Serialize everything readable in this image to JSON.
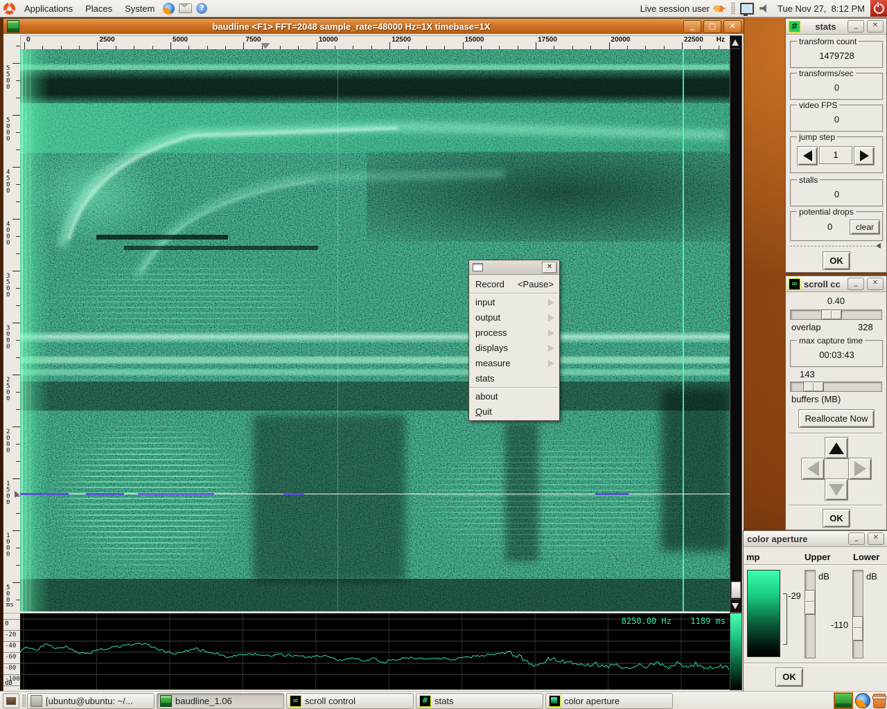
{
  "colors": {
    "titlebar_orange": "#cf7426",
    "spectro_green": "#2fe39b",
    "panel_bg": "#efebe5",
    "desktop_brown": "#5a2e0e"
  },
  "panel": {
    "menus": [
      "Applications",
      "Places",
      "System"
    ],
    "help_glyph": "?",
    "user_label": "Live session user",
    "clock": "Tue Nov 27,  8:12 PM"
  },
  "baudline": {
    "title": "baudline  <F1> FFT=2048 sample_rate=48000 Hz=1X timebase=1X",
    "window_buttons": {
      "minimize": "_",
      "maximize": "□",
      "close": "✕"
    },
    "freq_axis": {
      "ticks": [
        "0",
        "2500",
        "5000",
        "7500",
        "10000",
        "12500",
        "15000",
        "17500",
        "20000",
        "22500"
      ],
      "unit": "Hz",
      "marker_hz": 8250
    },
    "time_axis": {
      "ticks": [
        "5500",
        "5000",
        "4500",
        "4000",
        "3500",
        "3000",
        "2500",
        "2000",
        "1500",
        "1000",
        "500"
      ],
      "unit": "ms",
      "marker_ms": 1189
    },
    "db_axis": {
      "ticks": [
        "0",
        "-20",
        "-40",
        "-60",
        "-80",
        "-100"
      ],
      "unit": "dB"
    },
    "readout": {
      "freq": "8250.00 Hz",
      "time": "1189 ms"
    },
    "spectrum_trace": [
      [
        0,
        -58
      ],
      [
        10,
        -50
      ],
      [
        22,
        -56
      ],
      [
        38,
        -46
      ],
      [
        52,
        -52
      ],
      [
        66,
        -49
      ],
      [
        80,
        -58
      ],
      [
        95,
        -64
      ],
      [
        110,
        -57
      ],
      [
        130,
        -52
      ],
      [
        150,
        -49
      ],
      [
        168,
        -44
      ],
      [
        180,
        -46
      ],
      [
        195,
        -52
      ],
      [
        210,
        -60
      ],
      [
        225,
        -63
      ],
      [
        240,
        -57
      ],
      [
        255,
        -54
      ],
      [
        268,
        -58
      ],
      [
        285,
        -63
      ],
      [
        300,
        -68
      ],
      [
        320,
        -66
      ],
      [
        340,
        -64
      ],
      [
        360,
        -66
      ],
      [
        380,
        -65
      ],
      [
        400,
        -67
      ],
      [
        420,
        -69
      ],
      [
        435,
        -66
      ],
      [
        450,
        -71
      ],
      [
        465,
        -74
      ],
      [
        480,
        -71
      ],
      [
        495,
        -76
      ],
      [
        510,
        -72
      ],
      [
        525,
        -78
      ],
      [
        540,
        -73
      ],
      [
        555,
        -71
      ],
      [
        570,
        -70
      ],
      [
        585,
        -72
      ],
      [
        600,
        -73
      ],
      [
        615,
        -71
      ],
      [
        630,
        -73
      ],
      [
        645,
        -69
      ],
      [
        660,
        -67
      ],
      [
        675,
        -64
      ],
      [
        690,
        -62
      ],
      [
        705,
        -62
      ],
      [
        715,
        -64
      ],
      [
        725,
        -70
      ],
      [
        735,
        -78
      ],
      [
        742,
        -88
      ],
      [
        750,
        -80
      ],
      [
        760,
        -74
      ],
      [
        772,
        -72
      ],
      [
        785,
        -75
      ],
      [
        800,
        -79
      ],
      [
        815,
        -83
      ],
      [
        830,
        -79
      ],
      [
        845,
        -86
      ],
      [
        860,
        -82
      ],
      [
        875,
        -87
      ],
      [
        890,
        -84
      ],
      [
        905,
        -86
      ],
      [
        920,
        -81
      ],
      [
        935,
        -88
      ],
      [
        948,
        -80
      ],
      [
        960,
        -86
      ],
      [
        975,
        -82
      ],
      [
        990,
        -87
      ],
      [
        1005,
        -84
      ],
      [
        1024,
        -88
      ]
    ]
  },
  "menu": {
    "record": {
      "label": "Record",
      "accel": "<Pause>"
    },
    "items": [
      {
        "label": "input",
        "submenu": true
      },
      {
        "label": "output",
        "submenu": true
      },
      {
        "label": "process",
        "submenu": true
      },
      {
        "label": "displays",
        "submenu": true
      },
      {
        "label": "measure",
        "submenu": true
      },
      {
        "label": "stats",
        "submenu": false
      }
    ],
    "about_label": "about",
    "quit_label": "Quit"
  },
  "stats": {
    "title": "stats",
    "icon_glyph": "#",
    "buttons": {
      "minimize": "_",
      "close": "✕"
    },
    "groups": [
      {
        "label": "transform count",
        "value": "1479728"
      },
      {
        "label": "transforms/sec",
        "value": "0"
      },
      {
        "label": "video FPS",
        "value": "0"
      }
    ],
    "jump_step": {
      "label": "jump step",
      "value": "1"
    },
    "stalls": {
      "label": "stalls",
      "value": "0"
    },
    "potential_drops": {
      "label": "potential drops",
      "value": "0",
      "clear_label": "clear"
    },
    "ok_label": "OK"
  },
  "scroll_control": {
    "title_visible": "scroll cc",
    "title_full": "scroll control",
    "icon_glyph": "∞",
    "buttons": {
      "minimize": "_",
      "close": "✕"
    },
    "slider1_value": "0.40",
    "overlap_label": "overlap",
    "overlap_value": "328",
    "max_capture": {
      "label": "max capture time",
      "value": "00:03:43"
    },
    "slider2_value": "143",
    "buffers_label": "buffers (MB)",
    "reallocate_label": "Reallocate Now",
    "ok_label": "OK"
  },
  "color_aperture": {
    "title": "color aperture",
    "buttons": {
      "minimize": "_",
      "close": "✕"
    },
    "ramp_label_visible": "mp",
    "upper_label": "Upper",
    "lower_label": "Lower",
    "upper_unit": "dB",
    "lower_unit": "dB",
    "upper_value": "-29",
    "lower_value": "-110",
    "ok_label": "OK"
  },
  "taskbar": {
    "buttons": [
      {
        "label": "[ubuntu@ubuntu: ~/...",
        "icon": "terminal",
        "glyph": "",
        "active": false
      },
      {
        "label": "baudline_1.06",
        "icon": "baudline",
        "glyph": "",
        "active": true
      },
      {
        "label": "scroll control",
        "icon": "scroll",
        "glyph": "∞",
        "active": false
      },
      {
        "label": "stats",
        "icon": "stats",
        "glyph": "#",
        "active": false
      },
      {
        "label": "color aperture",
        "icon": "aperture",
        "glyph": "",
        "active": false
      }
    ]
  }
}
